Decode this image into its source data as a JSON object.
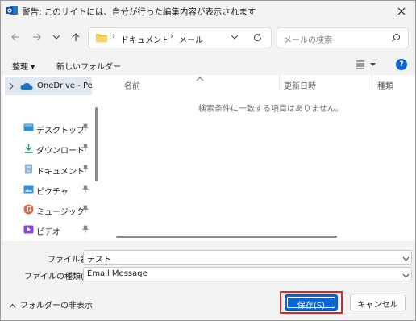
{
  "window": {
    "title": "警告: このサイトには、自分が行った編集内容が表示されます"
  },
  "address": {
    "sep1": "›",
    "segment1": "ドキュメント",
    "sep2": "›",
    "segment2": "メール"
  },
  "search": {
    "placeholder": "メールの検索"
  },
  "toolbar": {
    "organize": "整理 ▾",
    "new_folder": "新しいフォルダー",
    "help": "?"
  },
  "sidebar": {
    "onedrive": "OneDrive - Personal",
    "items": [
      {
        "label": "デスクトップ",
        "icon": "desktop-icon"
      },
      {
        "label": "ダウンロード",
        "icon": "download-icon"
      },
      {
        "label": "ドキュメント",
        "icon": "documents-icon"
      },
      {
        "label": "ピクチャ",
        "icon": "pictures-icon"
      },
      {
        "label": "ミュージック",
        "icon": "music-icon"
      },
      {
        "label": "ビデオ",
        "icon": "videos-icon"
      }
    ]
  },
  "files": {
    "columns": [
      "名前",
      "更新日時",
      "種類"
    ],
    "empty_message": "検索条件に一致する項目はありません。"
  },
  "form": {
    "filename_label": "ファイル名(N):",
    "filename_value": "テスト",
    "filetype_label": "ファイルの種類(T):",
    "filetype_value": "Email Message"
  },
  "footer": {
    "hide_folders": "フォルダーの非表示",
    "save": "保存(S)",
    "cancel": "キャンセル"
  },
  "colors": {
    "accent": "#0a64d6",
    "highlight_border": "#d9262c",
    "selected_bg": "#e1e7f0"
  }
}
